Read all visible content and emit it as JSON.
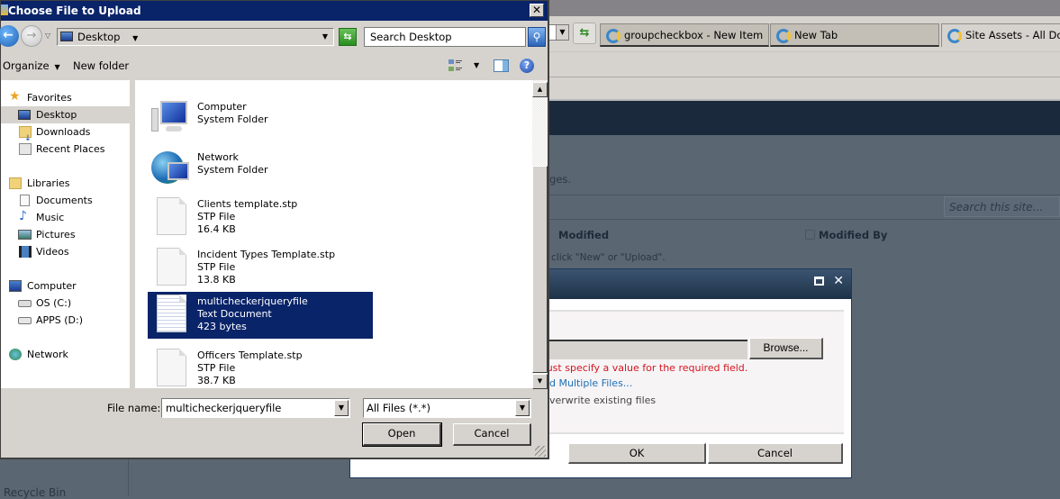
{
  "browser": {
    "tabs": [
      {
        "label": "groupcheckbox - New Item",
        "active": false
      },
      {
        "label": "New Tab",
        "active": false
      },
      {
        "label": "Site Assets - All Documents",
        "active": true
      }
    ],
    "page": {
      "instruction_fragment": "ges.",
      "search_placeholder": "Search this site...",
      "columns": [
        "Modified",
        "Modified By"
      ],
      "empty_hint": "click \"New\" or \"Upload\".",
      "recycle_bin": "Recycle Bin"
    }
  },
  "upload_modal": {
    "browse_label": "Browse...",
    "error_text": "must specify a value for the required field.",
    "upload_multiple_link": "d Multiple Files...",
    "overwrite_label": "verwrite existing files",
    "ok_label": "OK",
    "cancel_label": "Cancel"
  },
  "dialog": {
    "title": "Choose File to Upload",
    "address": "Desktop",
    "search_placeholder": "Search Desktop",
    "toolbar": {
      "organize": "Organize",
      "new_folder": "New folder"
    },
    "nav": [
      {
        "label": "Favorites",
        "icon": "star-icon",
        "level": 0,
        "selected": false
      },
      {
        "label": "Desktop",
        "icon": "desktop-icon",
        "level": 1,
        "selected": true
      },
      {
        "label": "Downloads",
        "icon": "downloads-folder-icon",
        "level": 1,
        "selected": false
      },
      {
        "label": "Recent Places",
        "icon": "recent-places-icon",
        "level": 1,
        "selected": false
      },
      {
        "label": "Libraries",
        "icon": "libraries-icon",
        "level": 0,
        "selected": false
      },
      {
        "label": "Documents",
        "icon": "documents-icon",
        "level": 1,
        "selected": false
      },
      {
        "label": "Music",
        "icon": "music-icon",
        "level": 1,
        "selected": false
      },
      {
        "label": "Pictures",
        "icon": "pictures-icon",
        "level": 1,
        "selected": false
      },
      {
        "label": "Videos",
        "icon": "videos-icon",
        "level": 1,
        "selected": false
      },
      {
        "label": "Computer",
        "icon": "computer-icon",
        "level": 0,
        "selected": false
      },
      {
        "label": "OS (C:)",
        "icon": "drive-c-icon",
        "level": 1,
        "selected": false
      },
      {
        "label": "APPS (D:)",
        "icon": "drive-d-icon",
        "level": 1,
        "selected": false
      },
      {
        "label": "Network",
        "icon": "network-icon",
        "level": 0,
        "selected": false
      }
    ],
    "files": [
      {
        "name": "Computer",
        "type": "System Folder",
        "size": "",
        "icon": "computer-icon",
        "selected": false
      },
      {
        "name": "Network",
        "type": "System Folder",
        "size": "",
        "icon": "network-icon",
        "selected": false
      },
      {
        "name": "Clients template.stp",
        "type": "STP File",
        "size": "16.4 KB",
        "icon": "file-icon",
        "selected": false
      },
      {
        "name": "Incident Types Template.stp",
        "type": "STP File",
        "size": "13.8 KB",
        "icon": "file-icon",
        "selected": false
      },
      {
        "name": "multicheckerjqueryfile",
        "type": "Text Document",
        "size": "423 bytes",
        "icon": "text-file-icon",
        "selected": true
      },
      {
        "name": "Officers Template.stp",
        "type": "STP File",
        "size": "38.7 KB",
        "icon": "file-icon",
        "selected": false
      }
    ],
    "file_name_label": "File name:",
    "file_name_value": "multicheckerjqueryfile",
    "file_type": "All Files (*.*)",
    "open_label": "Open",
    "cancel_label": "Cancel"
  },
  "colors": {
    "selection": "#0a246a",
    "error": "#d4151e",
    "link": "#1e6fb4",
    "sp_header": "#1a2a3c"
  }
}
